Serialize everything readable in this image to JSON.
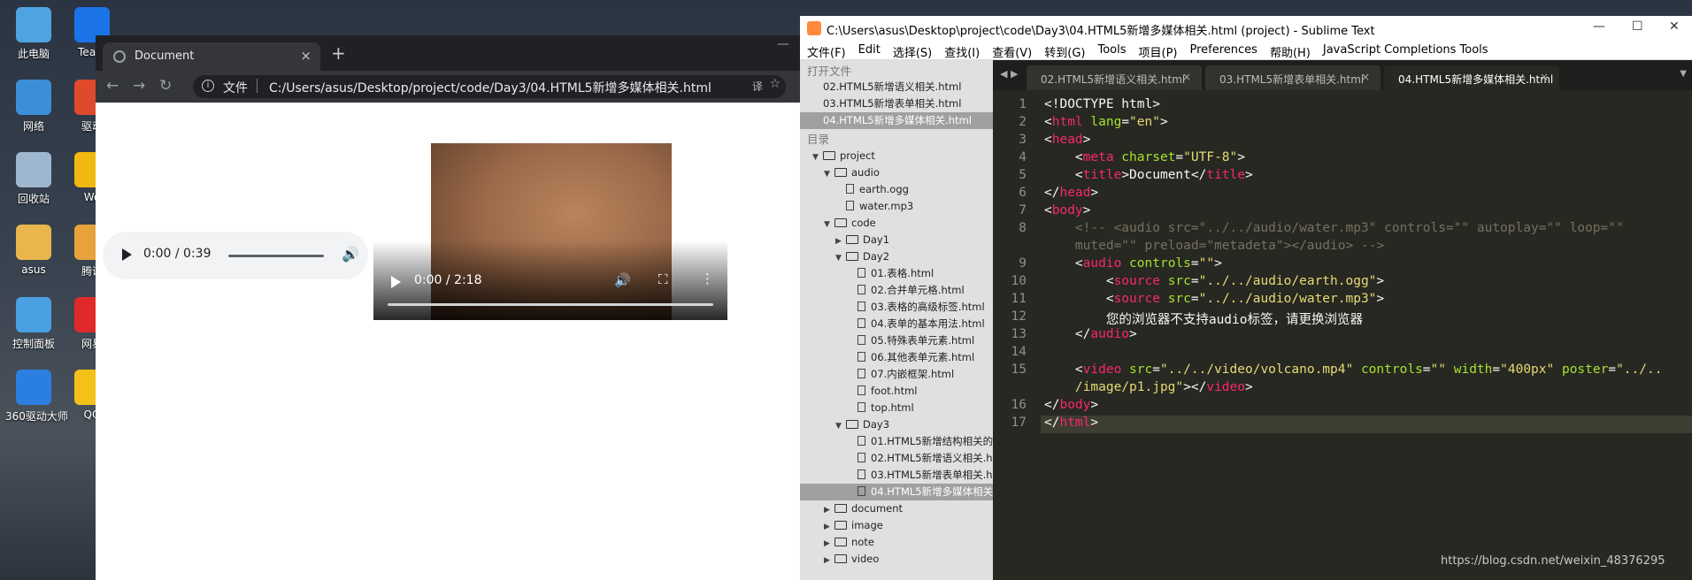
{
  "desktop": {
    "icons": [
      {
        "label": "此电脑",
        "color": "#4fa3e0"
      },
      {
        "label": "网络",
        "color": "#3d8ed8"
      },
      {
        "label": "回收站",
        "color": "#9fb6cf"
      },
      {
        "label": "asus",
        "color": "#e8b64c"
      },
      {
        "label": "控制面板",
        "color": "#4aa0e0"
      },
      {
        "label": "360驱动大师",
        "color": "#2b7fe0"
      }
    ],
    "icons2": [
      {
        "label": "Team",
        "color": "#1a74e8"
      },
      {
        "label": "驱动",
        "color": "#e04a2c"
      },
      {
        "label": "We",
        "color": "#f1b90f"
      },
      {
        "label": "腾讯",
        "color": "#e8a23c"
      },
      {
        "label": "网易",
        "color": "#e02a2a"
      },
      {
        "label": "QQ",
        "color": "#f5c018"
      }
    ]
  },
  "browser": {
    "tab_title": "Document",
    "tab_close": "×",
    "new_tab": "+",
    "minimize": "—",
    "back": "←",
    "forward": "→",
    "reload": "↻",
    "scheme_label": "文件",
    "url": "C:/Users/asus/Desktop/project/code/Day3/04.HTML5新增多媒体相关.html",
    "translate_icon": "译",
    "star": "☆"
  },
  "audio": {
    "time": "0:00 / 0:39",
    "volume": "🔊"
  },
  "video": {
    "time": "0:00 / 2:18",
    "volume": "🔊",
    "fullscreen": "⛶",
    "more": "⋮"
  },
  "sublime": {
    "title": "C:\\Users\\asus\\Desktop\\project\\code\\Day3\\04.HTML5新增多媒体相关.html (project) - Sublime Text",
    "win_min": "—",
    "win_max": "☐",
    "win_close": "✕",
    "menu": [
      "文件(F)",
      "Edit",
      "选择(S)",
      "查找(I)",
      "查看(V)",
      "转到(G)",
      "Tools",
      "项目(P)",
      "Preferences",
      "帮助(H)",
      "JavaScript Completions Tools"
    ],
    "sidebar": {
      "open_files_label": "打开文件",
      "open_files": [
        {
          "name": "02.HTML5新增语义相关.html",
          "selected": false
        },
        {
          "name": "03.HTML5新增表单相关.html",
          "selected": false
        },
        {
          "name": "04.HTML5新增多媒体相关.html",
          "selected": true
        }
      ],
      "folders_label": "目录",
      "tree": [
        {
          "name": "project",
          "type": "folder",
          "depth": 0,
          "open": true
        },
        {
          "name": "audio",
          "type": "folder",
          "depth": 1,
          "open": true
        },
        {
          "name": "earth.ogg",
          "type": "file",
          "depth": 2
        },
        {
          "name": "water.mp3",
          "type": "file",
          "depth": 2
        },
        {
          "name": "code",
          "type": "folder",
          "depth": 1,
          "open": true
        },
        {
          "name": "Day1",
          "type": "folder",
          "depth": 2,
          "open": false
        },
        {
          "name": "Day2",
          "type": "folder",
          "depth": 2,
          "open": true
        },
        {
          "name": "01.表格.html",
          "type": "file",
          "depth": 3
        },
        {
          "name": "02.合并单元格.html",
          "type": "file",
          "depth": 3
        },
        {
          "name": "03.表格的高级标签.html",
          "type": "file",
          "depth": 3
        },
        {
          "name": "04.表单的基本用法.html",
          "type": "file",
          "depth": 3
        },
        {
          "name": "05.特殊表单元素.html",
          "type": "file",
          "depth": 3
        },
        {
          "name": "06.其他表单元素.html",
          "type": "file",
          "depth": 3
        },
        {
          "name": "07.内嵌框架.html",
          "type": "file",
          "depth": 3
        },
        {
          "name": "foot.html",
          "type": "file",
          "depth": 3
        },
        {
          "name": "top.html",
          "type": "file",
          "depth": 3
        },
        {
          "name": "Day3",
          "type": "folder",
          "depth": 2,
          "open": true
        },
        {
          "name": "01.HTML5新增结构相关的",
          "type": "file",
          "depth": 3
        },
        {
          "name": "02.HTML5新增语义相关.h",
          "type": "file",
          "depth": 3
        },
        {
          "name": "03.HTML5新增表单相关.h",
          "type": "file",
          "depth": 3
        },
        {
          "name": "04.HTML5新增多媒体相关",
          "type": "file",
          "depth": 3,
          "selected": true
        },
        {
          "name": "document",
          "type": "folder",
          "depth": 1,
          "open": false
        },
        {
          "name": "image",
          "type": "folder",
          "depth": 1,
          "open": false
        },
        {
          "name": "note",
          "type": "folder",
          "depth": 1,
          "open": false
        },
        {
          "name": "video",
          "type": "folder",
          "depth": 1,
          "open": false
        }
      ]
    },
    "tabs": [
      {
        "label": "02.HTML5新增语义相关.html",
        "active": false
      },
      {
        "label": "03.HTML5新增表单相关.html",
        "active": false
      },
      {
        "label": "04.HTML5新增多媒体相关.html",
        "active": true
      }
    ],
    "tab_close": "×",
    "line_numbers": [
      "1",
      "2",
      "3",
      "4",
      "5",
      "6",
      "7",
      "8",
      "",
      "9",
      "10",
      "11",
      "12",
      "13",
      "14",
      "15",
      "",
      "16",
      "17"
    ],
    "code_lines": [
      [
        {
          "t": "<!DOCTYPE html>",
          "c": ""
        }
      ],
      [
        {
          "t": "<",
          "c": ""
        },
        {
          "t": "html",
          "c": "tg"
        },
        {
          "t": " lang",
          "c": "at"
        },
        {
          "t": "=",
          "c": ""
        },
        {
          "t": "\"en\"",
          "c": "st"
        },
        {
          "t": ">",
          "c": ""
        }
      ],
      [
        {
          "t": "<",
          "c": ""
        },
        {
          "t": "head",
          "c": "tg"
        },
        {
          "t": ">",
          "c": ""
        }
      ],
      [
        {
          "t": "    <",
          "c": ""
        },
        {
          "t": "meta",
          "c": "tg"
        },
        {
          "t": " charset",
          "c": "at"
        },
        {
          "t": "=",
          "c": ""
        },
        {
          "t": "\"UTF-8\"",
          "c": "st"
        },
        {
          "t": ">",
          "c": ""
        }
      ],
      [
        {
          "t": "    <",
          "c": ""
        },
        {
          "t": "title",
          "c": "tg"
        },
        {
          "t": ">Document</",
          "c": ""
        },
        {
          "t": "title",
          "c": "tg"
        },
        {
          "t": ">",
          "c": ""
        }
      ],
      [
        {
          "t": "</",
          "c": ""
        },
        {
          "t": "head",
          "c": "tg"
        },
        {
          "t": ">",
          "c": ""
        }
      ],
      [
        {
          "t": "<",
          "c": ""
        },
        {
          "t": "body",
          "c": "tg"
        },
        {
          "t": ">",
          "c": ""
        }
      ],
      [
        {
          "t": "    <!-- <audio src=\"../../audio/water.mp3\" controls=\"\" autoplay=\"\" loop=\"\"",
          "c": "cm"
        }
      ],
      [
        {
          "t": "    muted=\"\" preload=\"metadeta\"></audio> -->",
          "c": "cm"
        }
      ],
      [
        {
          "t": "    <",
          "c": ""
        },
        {
          "t": "audio",
          "c": "tg"
        },
        {
          "t": " controls",
          "c": "at"
        },
        {
          "t": "=",
          "c": ""
        },
        {
          "t": "\"\"",
          "c": "st"
        },
        {
          "t": ">",
          "c": ""
        }
      ],
      [
        {
          "t": "        <",
          "c": ""
        },
        {
          "t": "source",
          "c": "tg"
        },
        {
          "t": " src",
          "c": "at"
        },
        {
          "t": "=",
          "c": ""
        },
        {
          "t": "\"../../audio/earth.ogg\"",
          "c": "st"
        },
        {
          "t": ">",
          "c": ""
        }
      ],
      [
        {
          "t": "        <",
          "c": ""
        },
        {
          "t": "source",
          "c": "tg"
        },
        {
          "t": " src",
          "c": "at"
        },
        {
          "t": "=",
          "c": ""
        },
        {
          "t": "\"../../audio/water.mp3\"",
          "c": "st"
        },
        {
          "t": ">",
          "c": ""
        }
      ],
      [
        {
          "t": "        您的浏览器不支持audio标签，请更换浏览器",
          "c": ""
        }
      ],
      [
        {
          "t": "    </",
          "c": ""
        },
        {
          "t": "audio",
          "c": "tg"
        },
        {
          "t": ">",
          "c": ""
        }
      ],
      [
        {
          "t": "",
          "c": ""
        }
      ],
      [
        {
          "t": "    <",
          "c": ""
        },
        {
          "t": "video",
          "c": "tg"
        },
        {
          "t": " src",
          "c": "at"
        },
        {
          "t": "=",
          "c": ""
        },
        {
          "t": "\"../../video/volcano.mp4\"",
          "c": "st"
        },
        {
          "t": " controls",
          "c": "at"
        },
        {
          "t": "=",
          "c": ""
        },
        {
          "t": "\"\"",
          "c": "st"
        },
        {
          "t": " width",
          "c": "at"
        },
        {
          "t": "=",
          "c": ""
        },
        {
          "t": "\"400px\"",
          "c": "st"
        },
        {
          "t": " poster",
          "c": "at"
        },
        {
          "t": "=",
          "c": ""
        },
        {
          "t": "\"../..",
          "c": "st"
        }
      ],
      [
        {
          "t": "    /image/p1.jpg\"",
          "c": "st"
        },
        {
          "t": "></",
          "c": ""
        },
        {
          "t": "video",
          "c": "tg"
        },
        {
          "t": ">",
          "c": ""
        }
      ],
      [
        {
          "t": "</",
          "c": ""
        },
        {
          "t": "body",
          "c": "tg"
        },
        {
          "t": ">",
          "c": ""
        }
      ],
      [
        {
          "t": "</",
          "c": ""
        },
        {
          "t": "html",
          "c": "tg"
        },
        {
          "t": ">",
          "c": ""
        }
      ]
    ],
    "current_line_index": 18
  },
  "watermark": "https://blog.csdn.net/weixin_48376295"
}
